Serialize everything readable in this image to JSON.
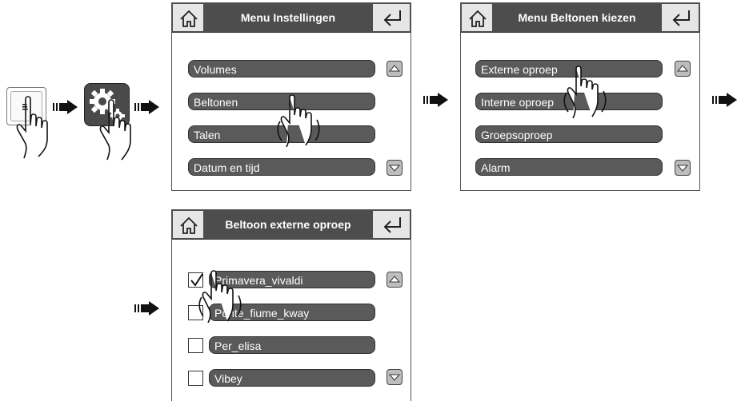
{
  "flow": {
    "menu_button_icon": "menu-lines-icon",
    "settings_app_icon": "gear-icon",
    "hand_icon": "pointing-hand-icon",
    "step_arrow_icon": "step-arrow-icon"
  },
  "screen1": {
    "title": "Menu Instellingen",
    "items": [
      "Volumes",
      "Beltonen",
      "Talen",
      "Datum en tijd"
    ]
  },
  "screen2": {
    "title": "Menu Beltonen kiezen",
    "items": [
      "Externe oproep",
      "Interne oproep",
      "Groepsoproep",
      "Alarm"
    ]
  },
  "screen3": {
    "title": "Beltoon externe oproep",
    "items": [
      {
        "label": "Primavera_vivaldi",
        "checked": true
      },
      {
        "label": "Ponte_fiume_kway",
        "checked": false
      },
      {
        "label": "Per_elisa",
        "checked": false
      },
      {
        "label": "Vibey",
        "checked": false
      }
    ]
  },
  "colors": {
    "titlebar": "#4d4d4d",
    "pill": "#5a5a5a",
    "button": "#e6e6e6"
  }
}
